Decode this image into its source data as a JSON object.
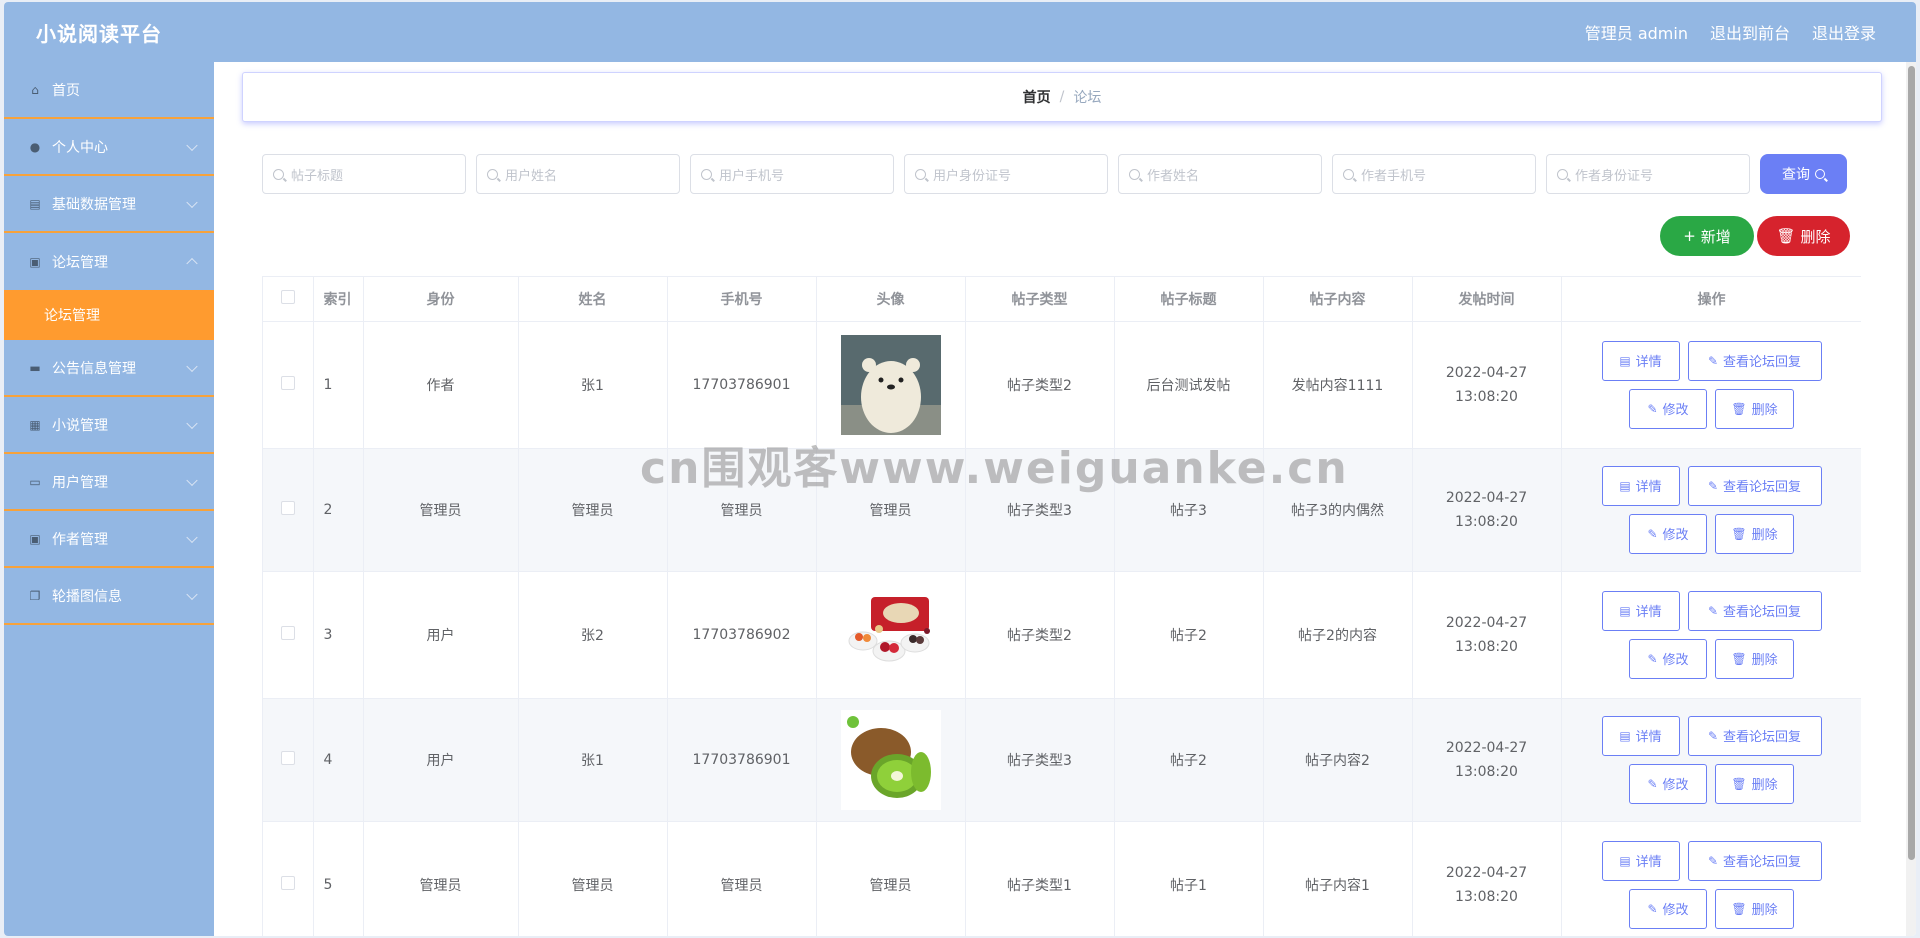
{
  "header": {
    "brand": "小说阅读平台",
    "user_label": "管理员 admin",
    "to_front": "退出到前台",
    "logout": "退出登录"
  },
  "sidebar": {
    "items": [
      {
        "label": "首页",
        "icon": "home-icon"
      },
      {
        "label": "个人中心",
        "icon": "user-icon"
      },
      {
        "label": "基础数据管理",
        "icon": "data-icon"
      },
      {
        "label": "论坛管理",
        "icon": "clipboard-icon",
        "open": true,
        "sub": [
          {
            "label": "论坛管理",
            "active": true
          }
        ]
      },
      {
        "label": "公告信息管理",
        "icon": "monitor-icon"
      },
      {
        "label": "小说管理",
        "icon": "grid-icon"
      },
      {
        "label": "用户管理",
        "icon": "chat-icon"
      },
      {
        "label": "作者管理",
        "icon": "clipboard-icon"
      },
      {
        "label": "轮播图信息",
        "icon": "copy-icon"
      }
    ],
    "active_color": "#ff9b2f",
    "bg_color": "#93b7e3"
  },
  "breadcrumb": {
    "home": "首页",
    "current": "论坛"
  },
  "search": {
    "placeholders": [
      "帖子标题",
      "用户姓名",
      "用户手机号",
      "用户身份证号",
      "作者姓名",
      "作者手机号",
      "作者身份证号"
    ],
    "query_label": "查询"
  },
  "actions": {
    "add_label": "新增",
    "delete_label": "删除"
  },
  "table": {
    "headers": [
      "索引",
      "身份",
      "姓名",
      "手机号",
      "头像",
      "帖子类型",
      "帖子标题",
      "帖子内容",
      "发帖时间",
      "操作"
    ],
    "op_labels": {
      "detail": "详情",
      "reply": "查看论坛回复",
      "edit": "修改",
      "delete": "删除"
    },
    "rows": [
      {
        "index": "1",
        "role": "作者",
        "name": "张1",
        "phone": "17703786901",
        "avatar": "polar-bear-image",
        "type": "帖子类型2",
        "title": "后台测试发帖",
        "content": "发帖内容1111",
        "time": "2022-04-27 13:08:20"
      },
      {
        "index": "2",
        "role": "管理员",
        "name": "管理员",
        "phone": "管理员",
        "avatar_text": "管理员",
        "type": "帖子类型3",
        "title": "帖子3",
        "content": "帖子3的内偶然",
        "time": "2022-04-27 13:08:20"
      },
      {
        "index": "3",
        "role": "用户",
        "name": "张2",
        "phone": "17703786902",
        "avatar": "snack-food-image",
        "type": "帖子类型2",
        "title": "帖子2",
        "content": "帖子2的内容",
        "time": "2022-04-27 13:08:20"
      },
      {
        "index": "4",
        "role": "用户",
        "name": "张1",
        "phone": "17703786901",
        "avatar": "kiwi-fruit-image",
        "type": "帖子类型3",
        "title": "帖子2",
        "content": "帖子内容2",
        "time": "2022-04-27 13:08:20"
      },
      {
        "index": "5",
        "role": "管理员",
        "name": "管理员",
        "phone": "管理员",
        "avatar_text": "管理员",
        "type": "帖子类型1",
        "title": "帖子1",
        "content": "帖子内容1",
        "time": "2022-04-27 13:08:20"
      }
    ]
  },
  "watermark": "cn围观客www.weiguanke.cn"
}
